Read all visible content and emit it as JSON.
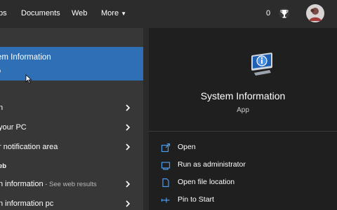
{
  "header": {
    "tabs": [
      {
        "label": "ps"
      },
      {
        "label": "Documents"
      },
      {
        "label": "Web"
      },
      {
        "label": "More"
      }
    ],
    "points": "0",
    "icons": [
      "trophy-icon",
      "avatar"
    ]
  },
  "left": {
    "best_match": {
      "title": "em Information",
      "subtitle": "p"
    },
    "rows": [
      {
        "label": "n",
        "extra": ""
      },
      {
        "label": "your PC",
        "extra": ""
      },
      {
        "label": "r notification area",
        "extra": ""
      }
    ],
    "web_section": "eb",
    "web_rows": [
      {
        "label": "n information",
        "extra": " - See web results"
      },
      {
        "label": "n information pc",
        "extra": ""
      }
    ]
  },
  "right": {
    "app_title": "System Information",
    "app_type": "App",
    "actions": [
      {
        "label": "Open",
        "icon": "open-icon"
      },
      {
        "label": "Run as administrator",
        "icon": "admin-shield-icon"
      },
      {
        "label": "Open file location",
        "icon": "file-location-icon"
      },
      {
        "label": "Pin to Start",
        "icon": "pin-icon"
      }
    ]
  },
  "colors": {
    "accent": "#2f6fb5",
    "left_bg": "#373737",
    "right_bg": "#1f1f1f",
    "topbar_bg": "#2c2c2c"
  }
}
